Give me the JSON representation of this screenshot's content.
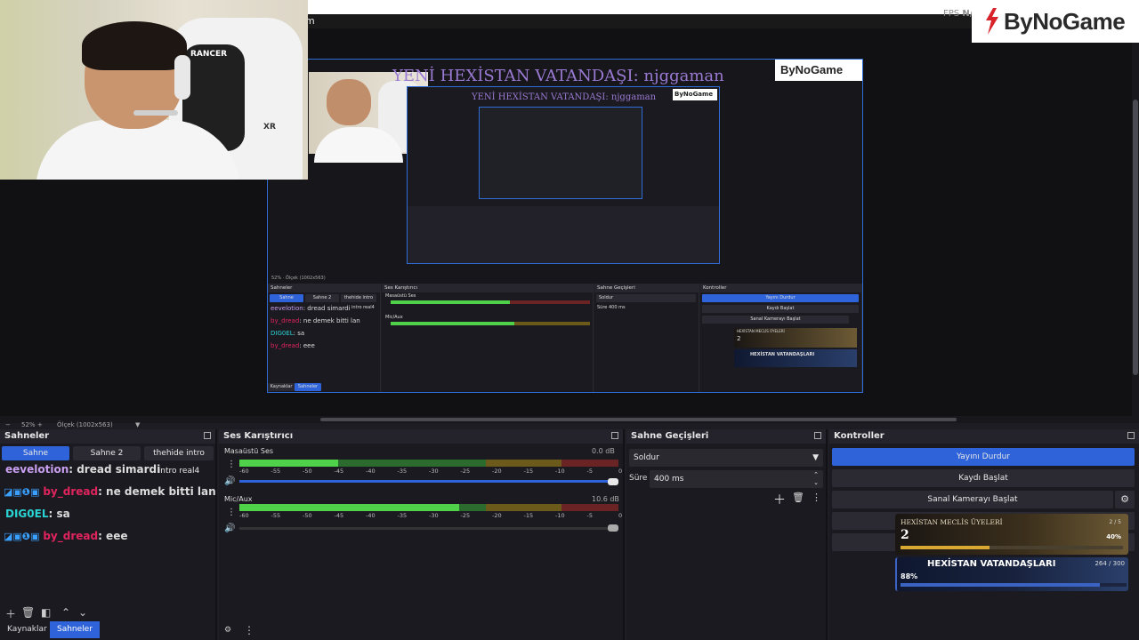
{
  "app": {
    "menu_fragment": "m",
    "fps_label": "FPS",
    "fps_value": "N/"
  },
  "logo": {
    "text": "ByNoGame"
  },
  "webcam": {
    "chair_brand": "RANCER",
    "chair_model": "XR"
  },
  "nested_preview": {
    "banner": "YENİ HEXİSTAN VATANDAŞI: njggaman",
    "logo": "ByNoGame",
    "inner_banner": "YENİ HEXİSTAN VATANDAŞI: njggaman",
    "inner_logo": "ByNoGame",
    "zoom": "52%",
    "scale": "Ölçek (1002x563)",
    "panels": {
      "scenes": "Sahneler",
      "mixer": "Ses Karıştırıcı",
      "transitions": "Sahne Geçişleri",
      "controls": "Kontroller",
      "tabs": [
        "Sahne",
        "Sahne 2",
        "thehide intro"
      ],
      "chat": [
        {
          "user": "eevelotion",
          "msg": ": dread simardi"
        },
        {
          "user": "by_dread",
          "msg": ": ne demek bitti lan"
        },
        {
          "user": "DIG0EL",
          "msg": ": sa"
        },
        {
          "user": "by_dread",
          "msg": ": eee"
        }
      ],
      "intro": "intro real4",
      "desktop": "Masaüstü Ses",
      "mic": "Mic/Aux",
      "fade": "Soldur",
      "duration_label": "Süre",
      "duration": "400 ms",
      "stop_stream": "Yayını Durdur",
      "start_record": "Kaydı Başlat",
      "virtual_cam": "Sanal Kamerayı Başlat",
      "w1_title": "HEXİSTAN MECLİS ÜYELERİ",
      "w1_value": "2",
      "w2_title": "HEXİSTAN VATANDAŞLARI",
      "bottom_tabs": [
        "Kaynaklar",
        "Sahneler"
      ]
    }
  },
  "status": {
    "zoom": "52%",
    "scale": "Ölçek (1002x563)"
  },
  "scenes_dock": {
    "title": "Sahneler",
    "tabs": [
      {
        "label": "Sahne",
        "active": true
      },
      {
        "label": "Sahne 2",
        "active": false
      },
      {
        "label": "thehide intro",
        "active": false
      }
    ],
    "intro_label": "intro real4",
    "chat": [
      {
        "user": "eevelotion",
        "msg": ": dread simardi",
        "color": "#c9a0f0"
      },
      {
        "user": "by_dread",
        "msg": ": ne demek bitti lan",
        "color": "#e0245e"
      },
      {
        "user": "DIG0EL",
        "msg": ": sa",
        "color": "#2ad3d3"
      },
      {
        "user": "by_dread",
        "msg": ": eee",
        "color": "#e0245e"
      }
    ],
    "bottom_tabs": [
      {
        "label": "Kaynaklar",
        "active": false
      },
      {
        "label": "Sahneler",
        "active": true
      }
    ]
  },
  "mixer_dock": {
    "title": "Ses Karıştırıcı",
    "ticks": [
      "-60",
      "-55",
      "-50",
      "-45",
      "-40",
      "-35",
      "-30",
      "-25",
      "-20",
      "-15",
      "-10",
      "-5",
      "0"
    ],
    "channels": [
      {
        "name": "Masaüstü Ses",
        "db": "0.0 dB",
        "level": 0.26,
        "volume": 1.0
      },
      {
        "name": "Mic/Aux",
        "db": "10.6 dB",
        "level": 0.58,
        "volume": 1.0
      }
    ]
  },
  "transitions_dock": {
    "title": "Sahne Geçişleri",
    "transition": "Soldur",
    "duration_label": "Süre",
    "duration": "400 ms"
  },
  "controls_dock": {
    "title": "Kontroller",
    "stop_stream": "Yayını Durdur",
    "start_record": "Kaydı Başlat",
    "virtual_cam": "Sanal Kamerayı Başlat"
  },
  "widgets": {
    "council": {
      "title": "HEXİSTAN MECLİS ÜYELERİ",
      "value": "2",
      "count": "2 / 5",
      "percent": "40%",
      "progress": 0.4
    },
    "citizens": {
      "title": "HEXİSTAN VATANDAŞLARI",
      "count": "264 / 300",
      "percent": "88%",
      "progress": 0.88
    }
  },
  "colors": {
    "accent": "#2f63d9",
    "dock_bg": "#1b1a20",
    "header_bg": "#24232b"
  }
}
